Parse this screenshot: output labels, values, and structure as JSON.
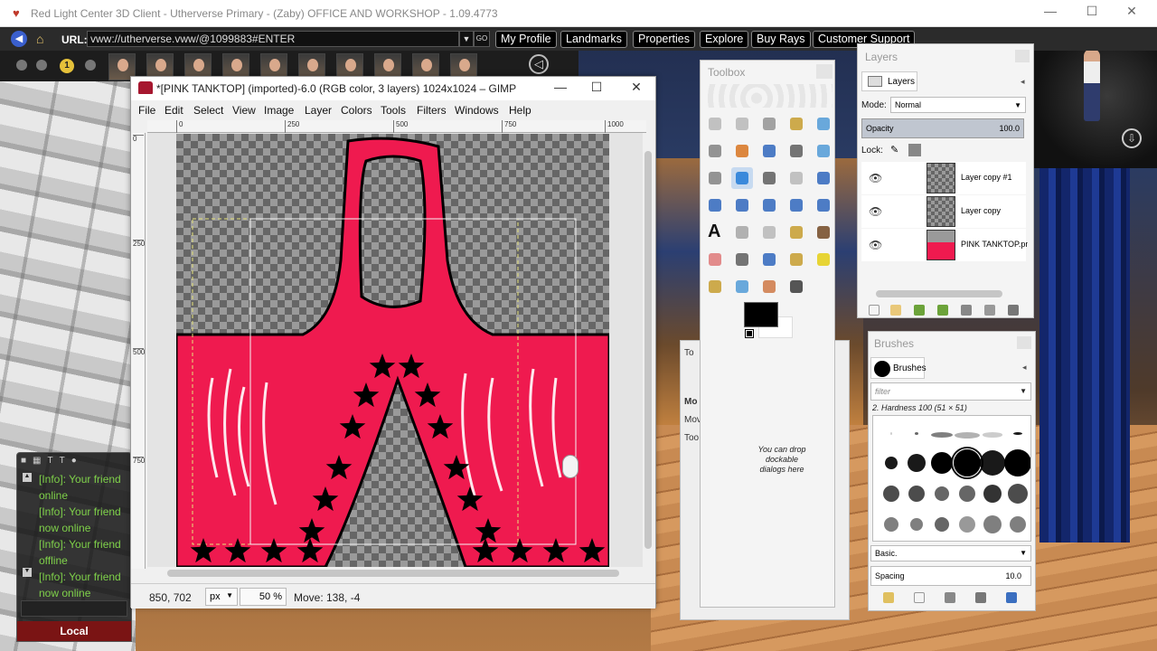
{
  "client": {
    "window_title": "Red Light Center 3D Client - Utherverse Primary - (Zaby) OFFICE AND WORKSHOP - 1.09.4773",
    "url_label": "URL:",
    "url_value": "vww://utherverse.vww/@1099883#ENTER",
    "nav_buttons": [
      "My Profile",
      "Landmarks",
      "Properties",
      "Explore",
      "Buy Rays",
      "Customer Support"
    ],
    "tray_coin": "1"
  },
  "chat": {
    "messages": [
      "[Info]: Your friend",
      "online",
      "[Info]: Your friend",
      "now online",
      "[Info]: Your friend",
      "offline",
      "[Info]: Your friend",
      "now online"
    ],
    "tab_label": "Local"
  },
  "gimp": {
    "window_title": "*[PINK TANKTOP] (imported)-6.0 (RGB color, 3 layers) 1024x1024 – GIMP",
    "menu": [
      "File",
      "Edit",
      "Select",
      "View",
      "Image",
      "Layer",
      "Colors",
      "Tools",
      "Filters",
      "Windows",
      "Help"
    ],
    "ruler_h": [
      "0",
      "250",
      "500",
      "750",
      "1000"
    ],
    "ruler_v": [
      "0",
      "250",
      "500",
      "750"
    ],
    "status": {
      "coords": "850, 702",
      "unit": "px",
      "zoom": "50 %",
      "message": "Move: 138, -4"
    }
  },
  "toolbox": {
    "title": "Toolbox",
    "hint": "You can drop dockable dialogs here",
    "colors": {
      "foreground": "#000000",
      "background": "#ffffff"
    }
  },
  "behind_dock": {
    "labels": [
      "To",
      "Mo",
      "Mov",
      "Too"
    ]
  },
  "layers": {
    "dock_title": "Layers",
    "tab_label": "Layers",
    "mode_label": "Mode:",
    "mode_value": "Normal",
    "opacity_label": "Opacity",
    "opacity_value": "100.0",
    "lock_label": "Lock:",
    "items": [
      {
        "name": "Layer copy #1"
      },
      {
        "name": "Layer copy"
      },
      {
        "name": "PINK TANKTOP.png"
      }
    ]
  },
  "brushes": {
    "dock_title": "Brushes",
    "tab_label": "Brushes",
    "filter_placeholder": "filter",
    "selected_brush": "2. Hardness 100 (51 × 51)",
    "preset": "Basic.",
    "spacing_label": "Spacing",
    "spacing_value": "10.0"
  },
  "artwork": {
    "shirt_color": "#ef1a4f",
    "star_color": "#000000"
  }
}
